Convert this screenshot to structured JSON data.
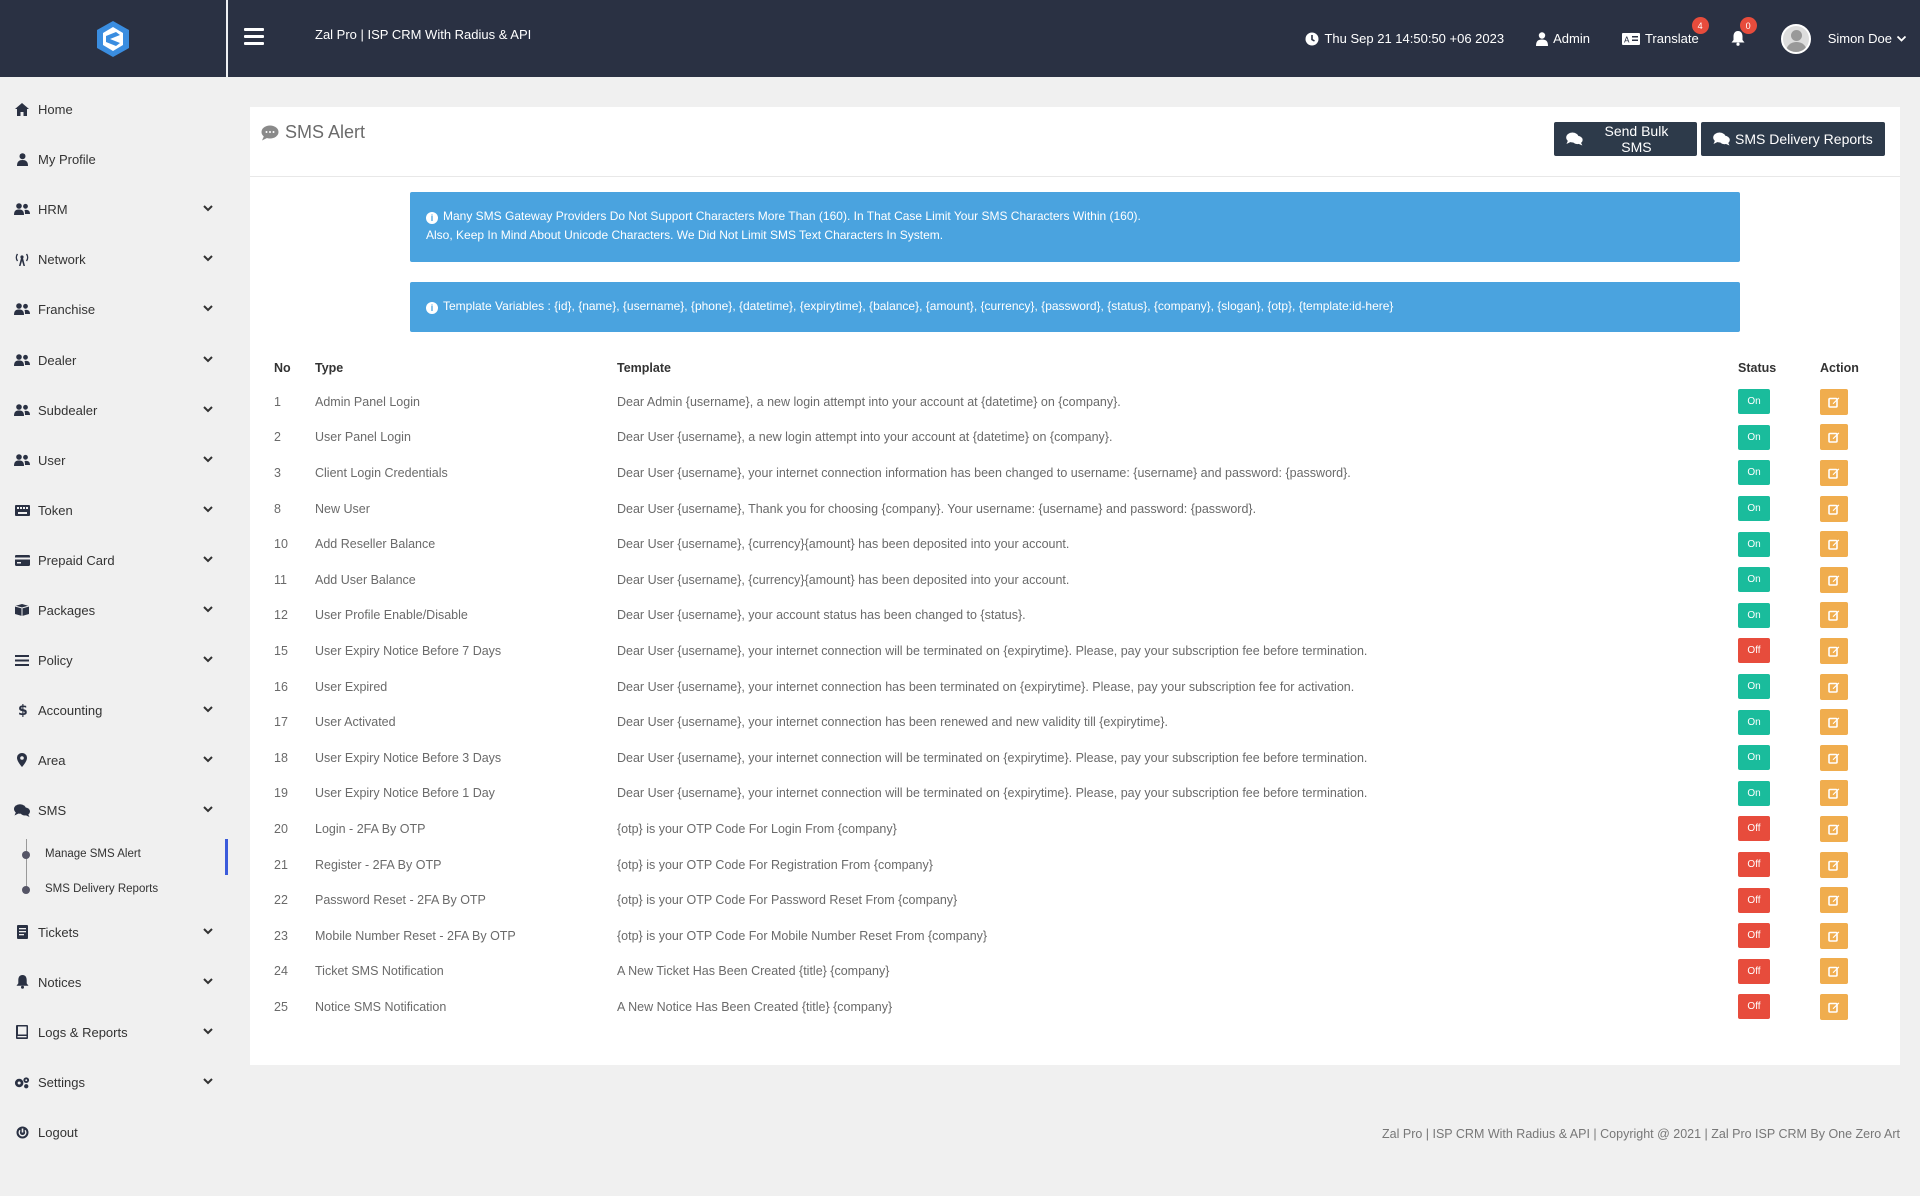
{
  "header": {
    "app_title": "Zal Pro | ISP CRM With Radius & API",
    "datetime": "Thu Sep 21 14:50:50 +06 2023",
    "admin_label": "Admin",
    "translate_label": "Translate",
    "translate_badge": "4",
    "notifications_badge": "0",
    "user_name": "Simon Doe"
  },
  "sidebar": {
    "items": [
      {
        "label": "Home",
        "icon": "home-icon",
        "chevron": false
      },
      {
        "label": "My Profile",
        "icon": "user-icon",
        "chevron": false
      },
      {
        "label": "HRM",
        "icon": "users-icon",
        "chevron": true
      },
      {
        "label": "Network",
        "icon": "antenna-icon",
        "chevron": true
      },
      {
        "label": "Franchise",
        "icon": "users-icon",
        "chevron": true
      },
      {
        "label": "Dealer",
        "icon": "users-icon",
        "chevron": true
      },
      {
        "label": "Subdealer",
        "icon": "users-icon",
        "chevron": true
      },
      {
        "label": "User",
        "icon": "users-icon",
        "chevron": true
      },
      {
        "label": "Token",
        "icon": "keyboard-icon",
        "chevron": true
      },
      {
        "label": "Prepaid Card",
        "icon": "credit-card-icon",
        "chevron": true
      },
      {
        "label": "Packages",
        "icon": "box-icon",
        "chevron": true
      },
      {
        "label": "Policy",
        "icon": "list-icon",
        "chevron": true
      },
      {
        "label": "Accounting",
        "icon": "dollar-icon",
        "chevron": true
      },
      {
        "label": "Area",
        "icon": "map-marker-icon",
        "chevron": true
      },
      {
        "label": "SMS",
        "icon": "comments-icon",
        "chevron": true
      },
      {
        "label": "Tickets",
        "icon": "document-icon",
        "chevron": true
      },
      {
        "label": "Notices",
        "icon": "bell-icon",
        "chevron": true
      },
      {
        "label": "Logs & Reports",
        "icon": "book-icon",
        "chevron": true
      },
      {
        "label": "Settings",
        "icon": "cogs-icon",
        "chevron": true
      },
      {
        "label": "Logout",
        "icon": "power-icon",
        "chevron": false
      }
    ],
    "sms_submenu": [
      "Manage SMS Alert",
      "SMS Delivery Reports"
    ]
  },
  "page": {
    "title": "SMS Alert",
    "send_bulk_label": "Send Bulk SMS",
    "delivery_reports_label": "SMS Delivery Reports",
    "alert1_line1": "Many SMS Gateway Providers Do Not Support Characters More Than (160). In That Case Limit Your SMS Characters Within (160).",
    "alert1_line2": "Also, Keep In Mind About Unicode Characters. We Did Not Limit SMS Text Characters In System.",
    "alert2": "Template Variables : {id}, {name}, {username}, {phone}, {datetime}, {expirytime}, {balance}, {amount}, {currency}, {password}, {status}, {company}, {slogan}, {otp}, {template:id-here}"
  },
  "table": {
    "headers": {
      "no": "No",
      "type": "Type",
      "template": "Template",
      "status": "Status",
      "action": "Action"
    },
    "rows": [
      {
        "no": "1",
        "type": "Admin Panel Login",
        "template": "Dear Admin {username}, a new login attempt into your account at {datetime} on {company}.",
        "status": "On"
      },
      {
        "no": "2",
        "type": "User Panel Login",
        "template": "Dear User {username}, a new login attempt into your account at {datetime} on {company}.",
        "status": "On"
      },
      {
        "no": "3",
        "type": "Client Login Credentials",
        "template": "Dear User {username}, your internet connection information has been changed to username: {username} and password: {password}.",
        "status": "On"
      },
      {
        "no": "8",
        "type": "New User",
        "template": "Dear User {username}, Thank you for choosing {company}. Your username: {username} and password: {password}.",
        "status": "On"
      },
      {
        "no": "10",
        "type": "Add Reseller Balance",
        "template": "Dear User {username}, {currency}{amount} has been deposited into your account.",
        "status": "On"
      },
      {
        "no": "11",
        "type": "Add User Balance",
        "template": "Dear User {username}, {currency}{amount} has been deposited into your account.",
        "status": "On"
      },
      {
        "no": "12",
        "type": "User Profile Enable/Disable",
        "template": "Dear User {username}, your account status has been changed to {status}.",
        "status": "On"
      },
      {
        "no": "15",
        "type": "User Expiry Notice Before 7 Days",
        "template": "Dear User {username}, your internet connection will be terminated on {expirytime}. Please, pay your subscription fee before termination.",
        "status": "Off"
      },
      {
        "no": "16",
        "type": "User Expired",
        "template": "Dear User {username}, your internet connection has been terminated on {expirytime}. Please, pay your subscription fee for activation.",
        "status": "On"
      },
      {
        "no": "17",
        "type": "User Activated",
        "template": "Dear User {username}, your internet connection has been renewed and new validity till {expirytime}.",
        "status": "On"
      },
      {
        "no": "18",
        "type": "User Expiry Notice Before 3 Days",
        "template": "Dear User {username}, your internet connection will be terminated on {expirytime}. Please, pay your subscription fee before termination.",
        "status": "On"
      },
      {
        "no": "19",
        "type": "User Expiry Notice Before 1 Day",
        "template": "Dear User {username}, your internet connection will be terminated on {expirytime}. Please, pay your subscription fee before termination.",
        "status": "On"
      },
      {
        "no": "20",
        "type": "Login - 2FA By OTP",
        "template": "{otp} is your OTP Code For Login From {company}",
        "status": "Off"
      },
      {
        "no": "21",
        "type": "Register - 2FA By OTP",
        "template": "{otp} is your OTP Code For Registration From {company}",
        "status": "Off"
      },
      {
        "no": "22",
        "type": "Password Reset - 2FA By OTP",
        "template": "{otp} is your OTP Code For Password Reset From {company}",
        "status": "Off"
      },
      {
        "no": "23",
        "type": "Mobile Number Reset - 2FA By OTP",
        "template": "{otp} is your OTP Code For Mobile Number Reset From {company}",
        "status": "Off"
      },
      {
        "no": "24",
        "type": "Ticket SMS Notification",
        "template": "A New Ticket Has Been Created {title} {company}",
        "status": "Off"
      },
      {
        "no": "25",
        "type": "Notice SMS Notification",
        "template": "A New Notice Has Been Created {title} {company}",
        "status": "Off"
      }
    ]
  },
  "footer": {
    "text": "Zal Pro | ISP CRM With Radius & API | Copyright @ 2021 | Zal Pro ISP CRM By One Zero Art"
  },
  "colors": {
    "header_bg": "#2a3143",
    "alert_bg": "#4aa3df",
    "status_on": "#1abc9c",
    "status_off": "#e74c3c",
    "edit": "#f0ad4e",
    "button_dark": "#2d3a4a"
  }
}
